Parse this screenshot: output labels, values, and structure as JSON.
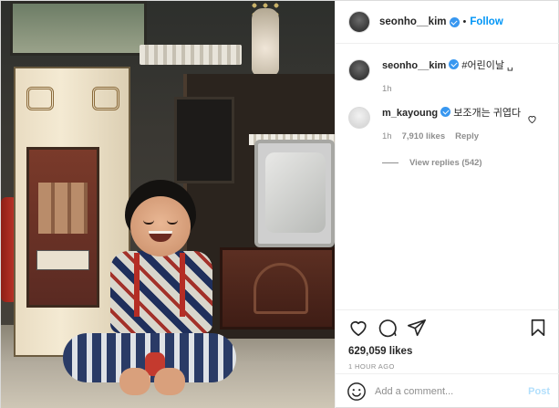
{
  "post": {
    "author": "seonho__kim",
    "follow_label": "Follow",
    "separator": "•"
  },
  "caption": {
    "username": "seonho__kim",
    "text": "#어린이날 ␣",
    "time": "1h"
  },
  "comments": [
    {
      "username": "m_kayoung",
      "text": "보조개는 귀엽다",
      "time": "1h",
      "likes": "7,910 likes",
      "reply_label": "Reply",
      "view_replies": "View replies (542)"
    }
  ],
  "actions": {
    "likes": "629,059 likes",
    "timestamp": "1 HOUR AGO"
  },
  "add_comment": {
    "placeholder": "Add a comment...",
    "post_label": "Post"
  },
  "icons": {
    "like": "heart-icon",
    "comment": "comment-icon",
    "share": "paper-plane-icon",
    "save": "bookmark-icon",
    "emoji": "smiley-icon",
    "verified": "verified-badge-icon"
  },
  "colors": {
    "accent": "#0095f6",
    "verified": "#3897f0",
    "muted": "#8e8e8e",
    "post_disabled": "#b2dffc"
  }
}
